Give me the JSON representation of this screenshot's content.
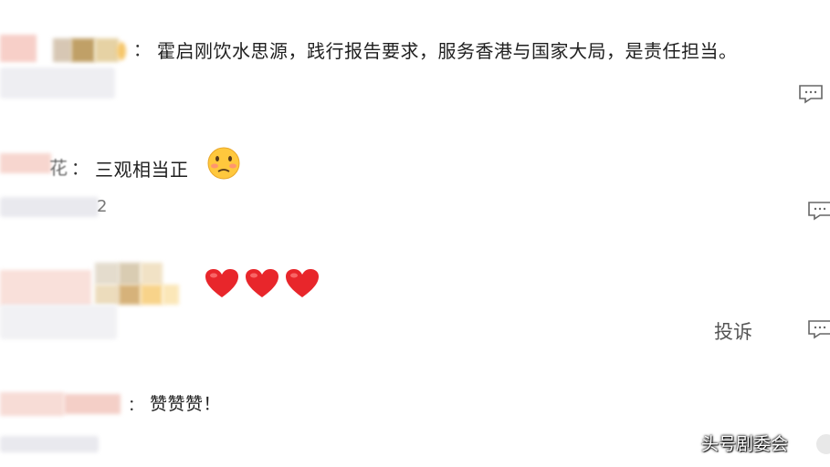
{
  "comments": [
    {
      "separator": "：",
      "text": "霍启刚饮水思源，践行报告要求，服务香港与国家大局，是责任担当。",
      "reply_icon": "comment-bubble-icon"
    },
    {
      "name_tail": "花",
      "separator": "：",
      "text": "三观相当正",
      "emoji": "flushed-face-emoji",
      "meta_tail": "2",
      "reply_icon": "comment-bubble-icon"
    },
    {
      "emojis": [
        "red-heart-emoji",
        "red-heart-emoji",
        "red-heart-emoji"
      ],
      "complain_label": "投诉",
      "reply_icon": "comment-bubble-icon"
    },
    {
      "separator": "：",
      "text": "赞赞赞！"
    }
  ],
  "watermark": "头号剧委会",
  "colors": {
    "background": "#ffffff",
    "heart": "#e8262b",
    "icon": "#666666"
  }
}
